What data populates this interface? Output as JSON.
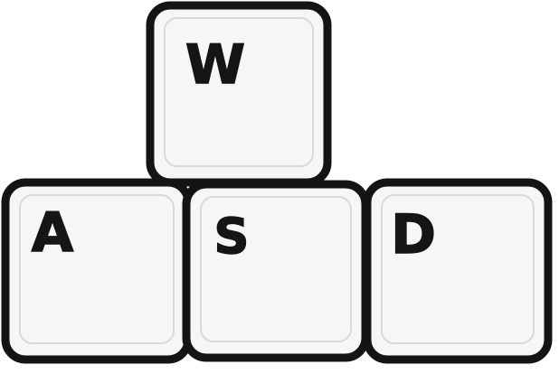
{
  "keys": {
    "w": {
      "label": "W"
    },
    "a": {
      "label": "A"
    },
    "s": {
      "label": "S"
    },
    "d": {
      "label": "D"
    }
  },
  "colors": {
    "key_fill": "#f6f6f6",
    "outline": "#141414",
    "background": "#ffffff"
  }
}
